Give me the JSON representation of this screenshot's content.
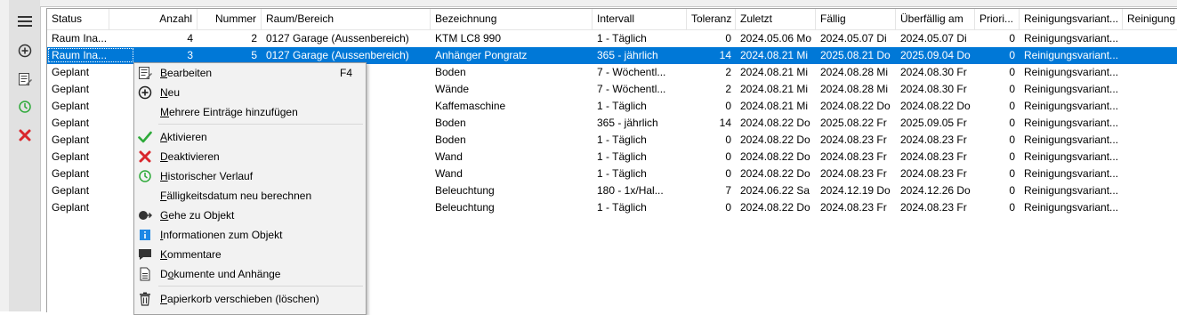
{
  "columns": [
    "Status",
    "Anzahl",
    "Nummer",
    "Raum/Bereich",
    "Bezeichnung",
    "Intervall",
    "Toleranz",
    "Zuletzt",
    "Fällig",
    "Überfällig am",
    "Priori...",
    "Reinigungsvariant...",
    "Reinigung"
  ],
  "rows": [
    {
      "status": "Raum Ina...",
      "anzahl": "4",
      "nummer": "2",
      "raum": "0127 Garage (Aussenbereich)",
      "bez": "KTM LC8 990",
      "intervall": "1 - Täglich",
      "toleranz": "0",
      "zuletzt": "2024.05.06 Mo",
      "faellig": "2024.05.07 Di",
      "ueber": "2024.05.07 Di",
      "prio": "0",
      "variante": "Reinigungsvariant...",
      "selected": false
    },
    {
      "status": "Raum Ina...",
      "anzahl": "3",
      "nummer": "5",
      "raum": "0127 Garage (Aussenbereich)",
      "bez": "Anhänger Pongratz",
      "intervall": "365 - jährlich",
      "toleranz": "14",
      "zuletzt": "2024.08.21 Mi",
      "faellig": "2025.08.21 Do",
      "ueber": "2025.09.04 Do",
      "prio": "0",
      "variante": "Reinigungsvariant...",
      "selected": true
    },
    {
      "status": "Geplant",
      "anzahl": "",
      "nummer": "",
      "raum": "",
      "bez": "Boden",
      "intervall": "7 - Wöchentl...",
      "toleranz": "2",
      "zuletzt": "2024.08.21 Mi",
      "faellig": "2024.08.28 Mi",
      "ueber": "2024.08.30 Fr",
      "prio": "0",
      "variante": "Reinigungsvariant...",
      "selected": false
    },
    {
      "status": "Geplant",
      "anzahl": "",
      "nummer": "",
      "raum": "",
      "bez": "Wände",
      "intervall": "7 - Wöchentl...",
      "toleranz": "2",
      "zuletzt": "2024.08.21 Mi",
      "faellig": "2024.08.28 Mi",
      "ueber": "2024.08.30 Fr",
      "prio": "0",
      "variante": "Reinigungsvariant...",
      "selected": false
    },
    {
      "status": "Geplant",
      "anzahl": "",
      "nummer": "",
      "raum": "",
      "bez": "Kaffemaschine",
      "intervall": "1 - Täglich",
      "toleranz": "0",
      "zuletzt": "2024.08.21 Mi",
      "faellig": "2024.08.22 Do",
      "ueber": "2024.08.22 Do",
      "prio": "0",
      "variante": "Reinigungsvariant...",
      "selected": false
    },
    {
      "status": "Geplant",
      "anzahl": "",
      "nummer": "",
      "raum": "",
      "bez": "Boden",
      "intervall": "365 - jährlich",
      "toleranz": "14",
      "zuletzt": "2024.08.22 Do",
      "faellig": "2025.08.22 Fr",
      "ueber": "2025.09.05 Fr",
      "prio": "0",
      "variante": "Reinigungsvariant...",
      "selected": false
    },
    {
      "status": "Geplant",
      "anzahl": "",
      "nummer": "",
      "raum": "",
      "bez": "Boden",
      "intervall": "1 - Täglich",
      "toleranz": "0",
      "zuletzt": "2024.08.22 Do",
      "faellig": "2024.08.23 Fr",
      "ueber": "2024.08.23 Fr",
      "prio": "0",
      "variante": "Reinigungsvariant...",
      "selected": false
    },
    {
      "status": "Geplant",
      "anzahl": "",
      "nummer": "",
      "raum": "",
      "bez": "Wand",
      "intervall": "1 - Täglich",
      "toleranz": "0",
      "zuletzt": "2024.08.22 Do",
      "faellig": "2024.08.23 Fr",
      "ueber": "2024.08.23 Fr",
      "prio": "0",
      "variante": "Reinigungsvariant...",
      "selected": false
    },
    {
      "status": "Geplant",
      "anzahl": "",
      "nummer": "",
      "raum": "",
      "bez": "Wand",
      "intervall": "1 - Täglich",
      "toleranz": "0",
      "zuletzt": "2024.08.22 Do",
      "faellig": "2024.08.23 Fr",
      "ueber": "2024.08.23 Fr",
      "prio": "0",
      "variante": "Reinigungsvariant...",
      "selected": false
    },
    {
      "status": "Geplant",
      "anzahl": "",
      "nummer": "",
      "raum": "",
      "bez": "Beleuchtung",
      "intervall": "180 - 1x/Hal...",
      "toleranz": "7",
      "zuletzt": "2024.06.22 Sa",
      "faellig": "2024.12.19 Do",
      "ueber": "2024.12.26 Do",
      "prio": "0",
      "variante": "Reinigungsvariant...",
      "selected": false
    },
    {
      "status": "Geplant",
      "anzahl": "",
      "nummer": "",
      "raum": "",
      "bez": "Beleuchtung",
      "intervall": "1 - Täglich",
      "toleranz": "0",
      "zuletzt": "2024.08.22 Do",
      "faellig": "2024.08.23 Fr",
      "ueber": "2024.08.23 Fr",
      "prio": "0",
      "variante": "Reinigungsvariant...",
      "selected": false
    }
  ],
  "menu": [
    {
      "label": "Bearbeiten",
      "accel": "B",
      "rest": "earbeiten",
      "shortcut": "F4",
      "icon": "edit-icon"
    },
    {
      "label": "Neu",
      "accel": "N",
      "rest": "eu",
      "shortcut": "",
      "icon": "plus-circle-icon"
    },
    {
      "label": "Mehrere Einträge hinzufügen",
      "accel": "M",
      "rest": "ehrere Einträge hinzufügen",
      "shortcut": "",
      "icon": ""
    },
    {
      "label": "Aktivieren",
      "accel": "A",
      "rest": "ktivieren",
      "shortcut": "",
      "icon": "check-icon"
    },
    {
      "label": "Deaktivieren",
      "accel": "D",
      "rest": "eaktivieren",
      "shortcut": "",
      "icon": "x-icon"
    },
    {
      "label": "Historischer Verlauf",
      "accel": "H",
      "rest": "istorischer Verlauf",
      "shortcut": "",
      "icon": "history-icon"
    },
    {
      "label": "Fälligkeitsdatum neu berechnen",
      "accel": "F",
      "rest": "älligkeitsdatum neu berechnen",
      "shortcut": "",
      "icon": ""
    },
    {
      "label": "Gehe zu Objekt",
      "accel": "G",
      "rest": "ehe zu Objekt",
      "shortcut": "",
      "icon": "goto-icon"
    },
    {
      "label": "Informationen zum Objekt",
      "accel": "I",
      "rest": "nformationen zum Objekt",
      "shortcut": "",
      "icon": "info-icon"
    },
    {
      "label": "Kommentare",
      "accel": "K",
      "rest": "ommentare",
      "shortcut": "",
      "icon": "comment-icon"
    },
    {
      "label": "Dokumente und Anhänge",
      "accel": "o",
      "pre": "D",
      "rest": "kumente und Anhänge",
      "shortcut": "",
      "icon": "document-icon"
    },
    {
      "label": "Papierkorb verschieben (löschen)",
      "accel": "P",
      "rest": "apierkorb verschieben (löschen)",
      "shortcut": "",
      "icon": "trash-icon"
    }
  ],
  "toolbar": [
    "menu-icon",
    "add-icon",
    "edit-icon",
    "history-icon",
    "delete-icon"
  ],
  "colors": {
    "selection": "#0078d7",
    "check": "#2eaa3a",
    "cross": "#d9262c",
    "info": "#1e88e5"
  }
}
